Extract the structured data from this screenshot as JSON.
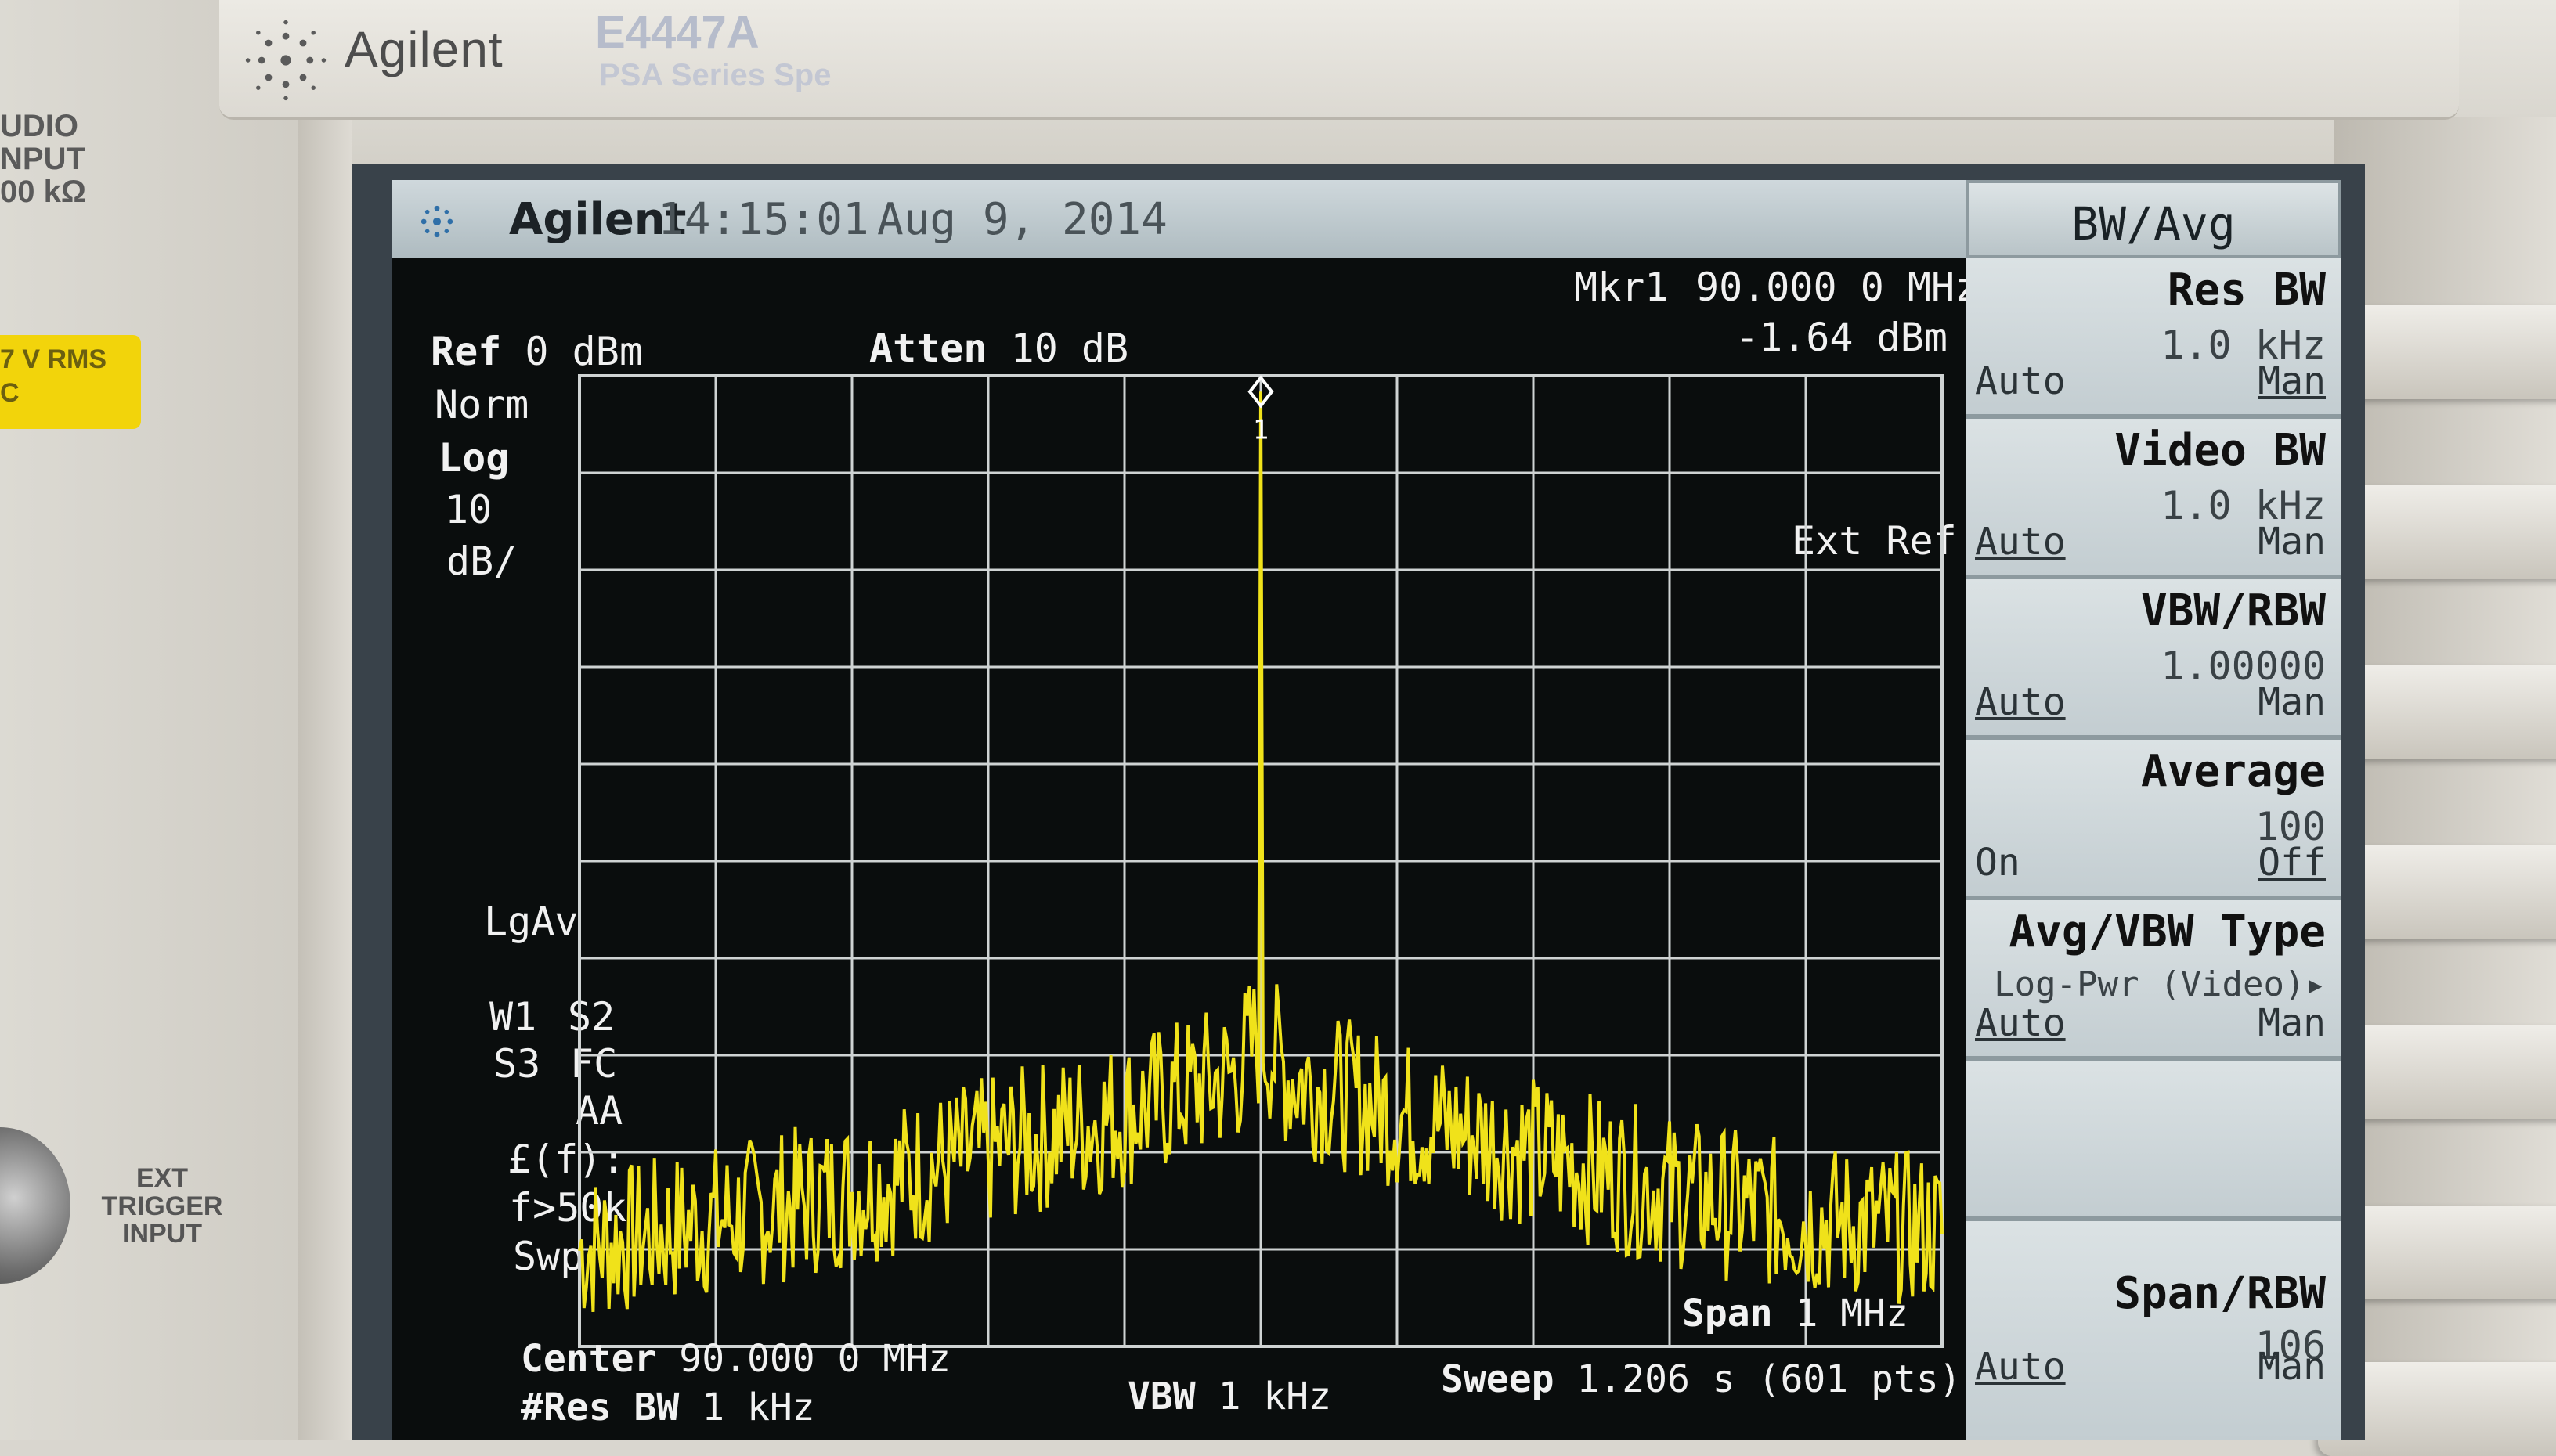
{
  "bezel": {
    "brand": "Agilent",
    "model": "E4447A",
    "series": "PSA Series Spe",
    "audio_label": "UDIO\nNPUT\n00 kΩ",
    "rms_label": "7 V RMS\nC",
    "trigger_label": "EXT\nTRIGGER\nINPUT"
  },
  "header": {
    "brand": "Agilent",
    "time": "14:15:01",
    "date": "Aug 9, 2014"
  },
  "marker": {
    "label": "Mkr1",
    "freq": "90.000 0 MHz",
    "amp": "-1.64 dBm",
    "number": "1"
  },
  "settings": {
    "ref_label": "Ref",
    "ref_value": "0 dBm",
    "atten_label": "Atten",
    "atten_value": "10 dB",
    "norm": "Norm",
    "log": "Log",
    "scale_value": "10",
    "scale_unit": "dB/",
    "ext_ref": "Ext Ref",
    "lgav": "LgAv",
    "w1": "W1",
    "s2": "S2",
    "s3": "S3",
    "fc": "FC",
    "aa": "AA",
    "lf": "£(f):",
    "f50k": "f>50k",
    "swp": "Swp"
  },
  "footer": {
    "center_label": "Center",
    "center_value": "90.000 0 MHz",
    "resbw_label": "#Res BW",
    "resbw_value": "1 kHz",
    "vbw_label": "VBW",
    "vbw_value": "1 kHz",
    "span_label": "Span",
    "span_value": "1 MHz",
    "sweep_label": "Sweep",
    "sweep_value": "1.206 s (601 pts)"
  },
  "softkeys": {
    "title": "BW/Avg",
    "keys": [
      {
        "label": "Res BW",
        "value": "1.0 kHz",
        "left": "Auto",
        "right": "Man"
      },
      {
        "label": "Video BW",
        "value": "1.0 kHz",
        "left": "Auto",
        "right": "Man"
      },
      {
        "label": "VBW/RBW",
        "value": "1.00000",
        "left": "Auto",
        "right": "Man"
      },
      {
        "label": "Average",
        "value": "100",
        "left": "On",
        "right": "Off"
      },
      {
        "label": "Avg/VBW Type",
        "value": "Log-Pwr (Video)▸",
        "left": "Auto",
        "right": "Man"
      },
      {
        "label": "",
        "value": "",
        "left": "",
        "right": ""
      },
      {
        "label": "Span/RBW",
        "value": "106",
        "left": "Auto",
        "right": "Man"
      }
    ]
  },
  "chart_data": {
    "type": "line",
    "x_center_mhz": 90.0,
    "x_span_mhz": 1.0,
    "xlim_mhz": [
      89.5,
      90.5
    ],
    "ylim_dbm": [
      -100,
      0
    ],
    "y_divisions": 10,
    "x_divisions": 10,
    "grid": true,
    "trace_color": "#f0e21a",
    "peak": {
      "x_mhz": 90.0,
      "y_dbm": -1.64
    },
    "noise_floor_envelope": {
      "x_mhz": [
        89.5,
        89.6,
        89.7,
        89.8,
        89.9,
        89.98,
        90.0,
        90.02,
        90.1,
        90.2,
        90.3,
        90.4,
        90.5
      ],
      "y_dbm": [
        -90,
        -87,
        -84,
        -80,
        -76,
        -72,
        -68,
        -72,
        -76,
        -80,
        -84,
        -87,
        -88
      ]
    }
  }
}
